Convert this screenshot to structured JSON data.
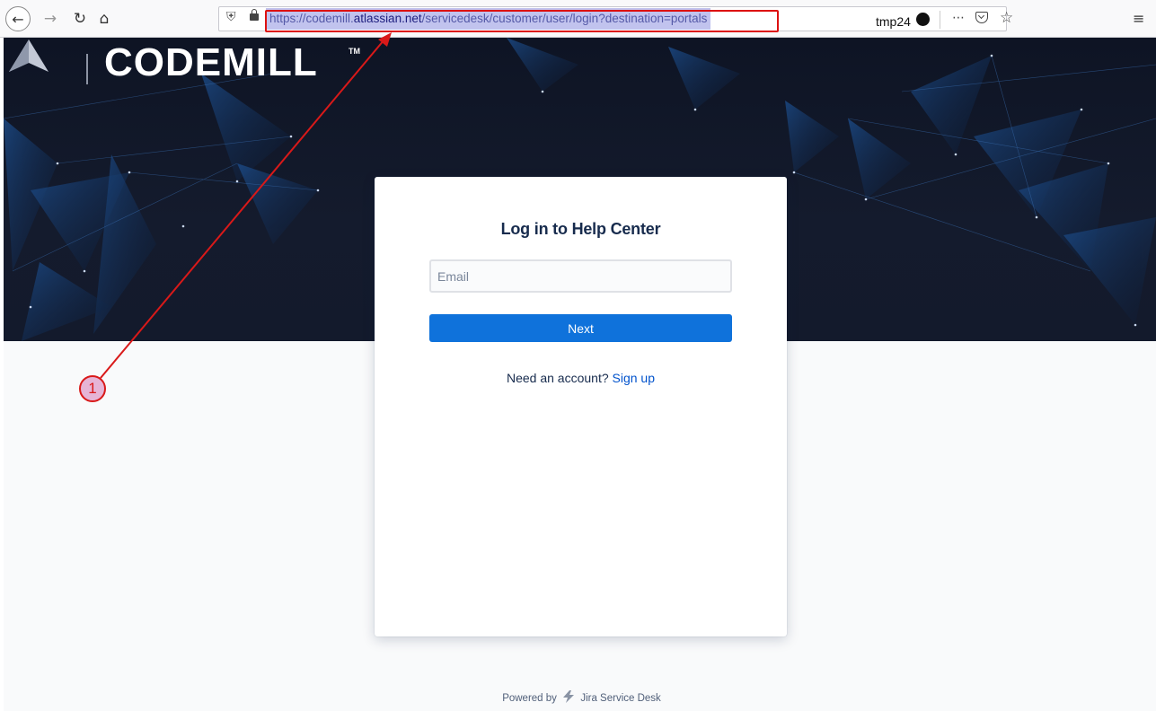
{
  "browser": {
    "url_prefix": "https://codemill.",
    "url_host": "atlassian.net",
    "url_path": "/servicedesk/customer/user/login?destination=portals",
    "profile_label": "tmp24",
    "icons": {
      "back": "back-arrow-icon",
      "forward": "forward-arrow-icon",
      "reload": "reload-icon",
      "home": "home-icon",
      "shield": "shield-icon",
      "lock": "lock-icon",
      "more": "more-icon",
      "pocket": "pocket-icon",
      "star": "star-icon",
      "menu": "hamburger-menu-icon"
    }
  },
  "brand": {
    "name": "CODEMILL",
    "tm": "TM"
  },
  "login": {
    "title": "Log in to Help Center",
    "email_placeholder": "Email",
    "email_value": "",
    "next_label": "Next",
    "signup_prompt": "Need an account?",
    "signup_link": "Sign up"
  },
  "footer": {
    "powered_by": "Powered by",
    "product": "Jira Service Desk"
  },
  "annotation": {
    "step": "1"
  },
  "colors": {
    "primary_button": "#0f72db",
    "link": "#0052cc",
    "title_text": "#172b4d",
    "banner_bg": "#131a2c",
    "annotation_red": "#d91919"
  }
}
